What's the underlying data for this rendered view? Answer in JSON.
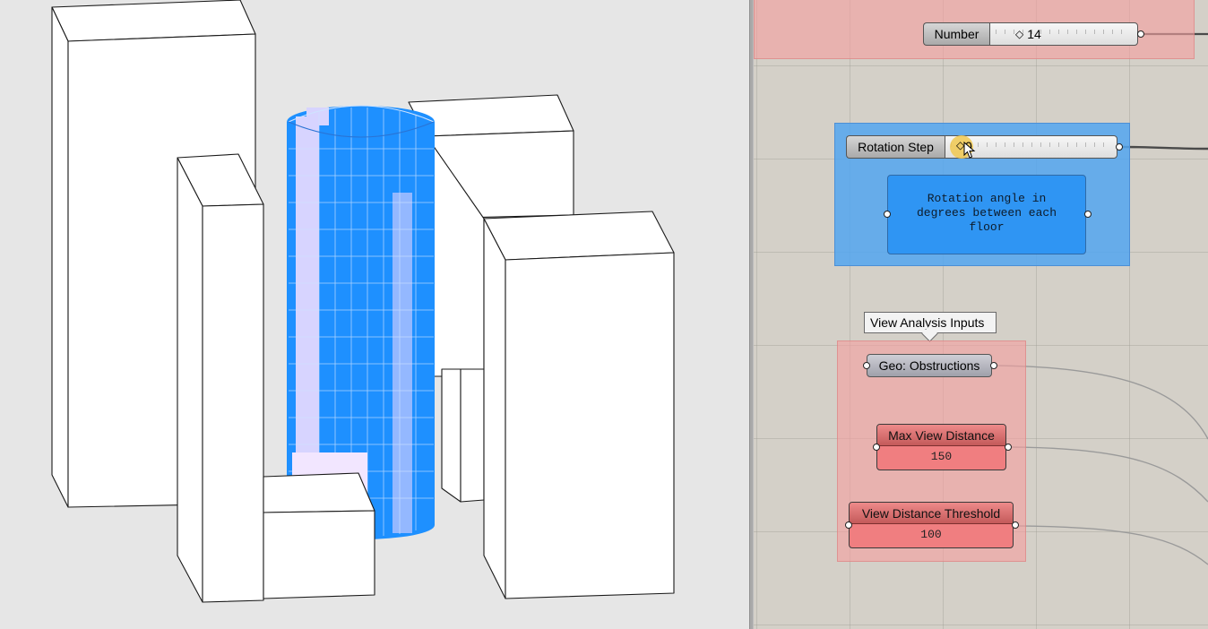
{
  "viewport": {
    "colors": {
      "background": "#e6e6e6",
      "building_fill": "#ffffff",
      "edge": "#1a1a1a",
      "tower_blue": "#1e90ff",
      "tower_light": "#d7d4ff"
    }
  },
  "canvas": {
    "number_slider": {
      "label": "Number",
      "value": "14"
    },
    "rotation_slider": {
      "label": "Rotation Step",
      "value": "0"
    },
    "note_panel": {
      "text": "Rotation angle in\ndegrees between each\nfloor"
    },
    "tooltip": {
      "text": "View Analysis Inputs"
    },
    "geo_param": {
      "label": "Geo: Obstructions"
    },
    "max_view_panel": {
      "title": "Max View Distance",
      "value": "150"
    },
    "threshold_panel": {
      "title": "View Distance Threshold",
      "value": "100"
    },
    "colors": {
      "canvas_bg": "#d4d0c8",
      "group_pink": "#f4a0a0",
      "group_blue": "#52a6f0",
      "panel_red": "#f07e80",
      "wire": "#555555"
    }
  }
}
